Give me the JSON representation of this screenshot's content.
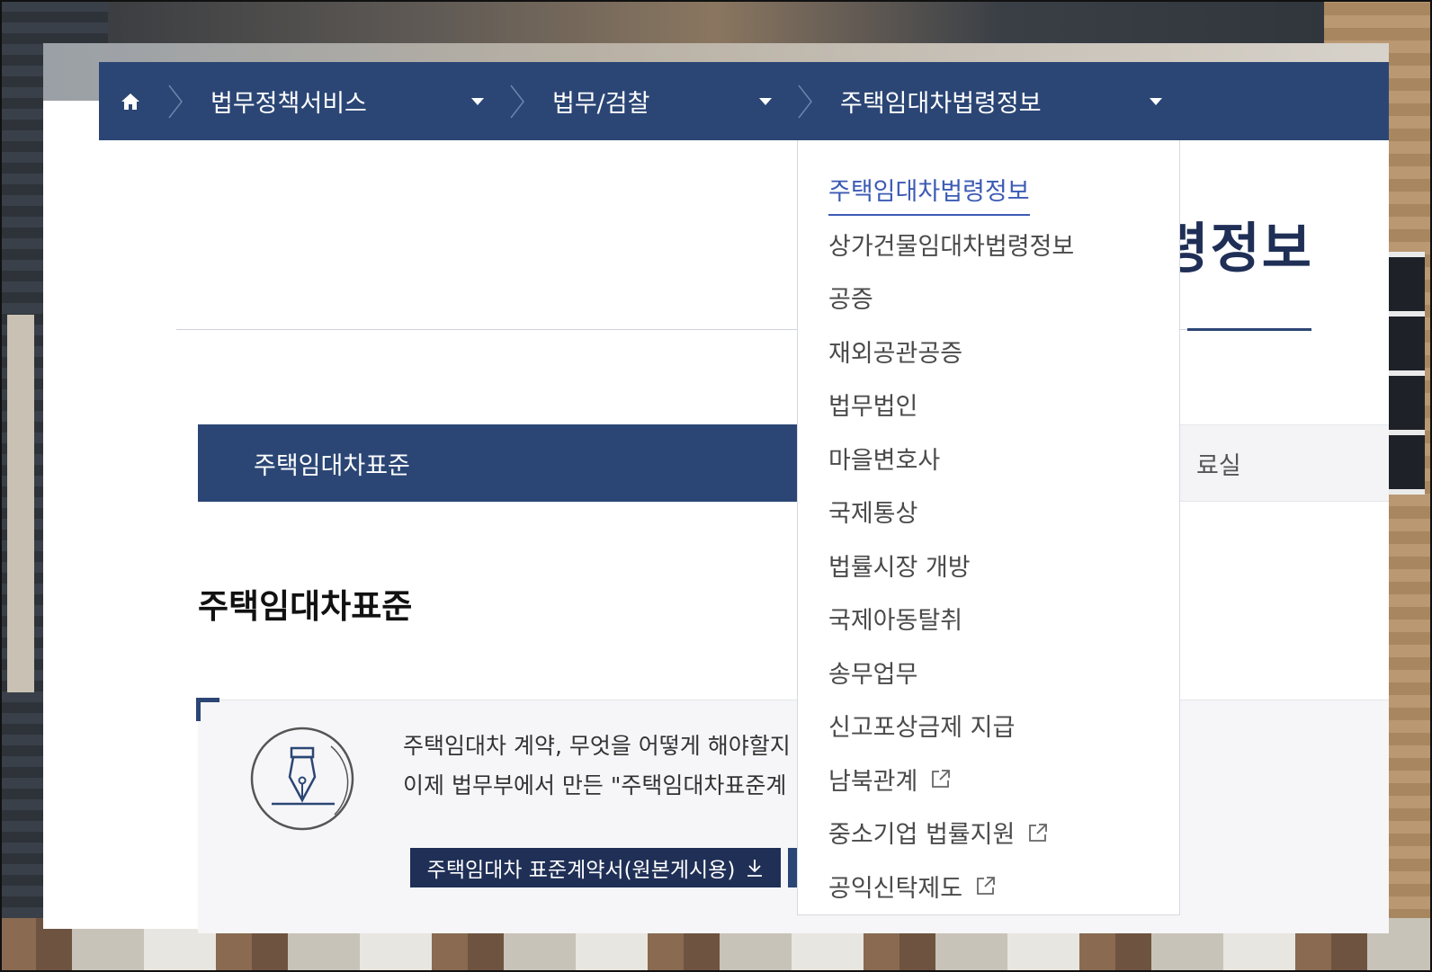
{
  "breadcrumb": {
    "items": [
      {
        "label": "법무정책서비스"
      },
      {
        "label": "법무/검찰"
      },
      {
        "label": "주택임대차법령정보"
      }
    ]
  },
  "page": {
    "title_visible_fragment": "령정보",
    "tabs": [
      {
        "label": "주택임대차표준",
        "active": true
      },
      {
        "label": "료실",
        "active": false
      }
    ],
    "section_heading": "주택임대차표준",
    "info_lines": [
      "주택임대차 계약, 무엇을 어떻게 해야할지",
      "이제 법무부에서 만든 \"주택임대차표준계"
    ],
    "download_button": "주택임대차 표준계약서(원본게시용)"
  },
  "dropdown": {
    "items": [
      {
        "label": "주택임대차법령정보",
        "active": true,
        "external": false
      },
      {
        "label": "상가건물임대차법령정보",
        "active": false,
        "external": false
      },
      {
        "label": "공증",
        "active": false,
        "external": false
      },
      {
        "label": "재외공관공증",
        "active": false,
        "external": false
      },
      {
        "label": "법무법인",
        "active": false,
        "external": false
      },
      {
        "label": "마을변호사",
        "active": false,
        "external": false
      },
      {
        "label": "국제통상",
        "active": false,
        "external": false
      },
      {
        "label": "법률시장 개방",
        "active": false,
        "external": false
      },
      {
        "label": "국제아동탈취",
        "active": false,
        "external": false
      },
      {
        "label": "송무업무",
        "active": false,
        "external": false
      },
      {
        "label": "신고포상금제 지급",
        "active": false,
        "external": false
      },
      {
        "label": "남북관계",
        "active": false,
        "external": true
      },
      {
        "label": "중소기업 법률지원",
        "active": false,
        "external": true
      },
      {
        "label": "공익신탁제도",
        "active": false,
        "external": true
      }
    ]
  },
  "colors": {
    "navy": "#2b4675",
    "dark_navy": "#1f2f56",
    "active_link": "#3d5bb5"
  },
  "icons": {
    "home": "home-icon",
    "separator": "chevron-right-icon",
    "caret": "caret-down-icon",
    "pen": "fountain-pen-icon",
    "download": "download-icon",
    "external": "external-link-icon"
  }
}
